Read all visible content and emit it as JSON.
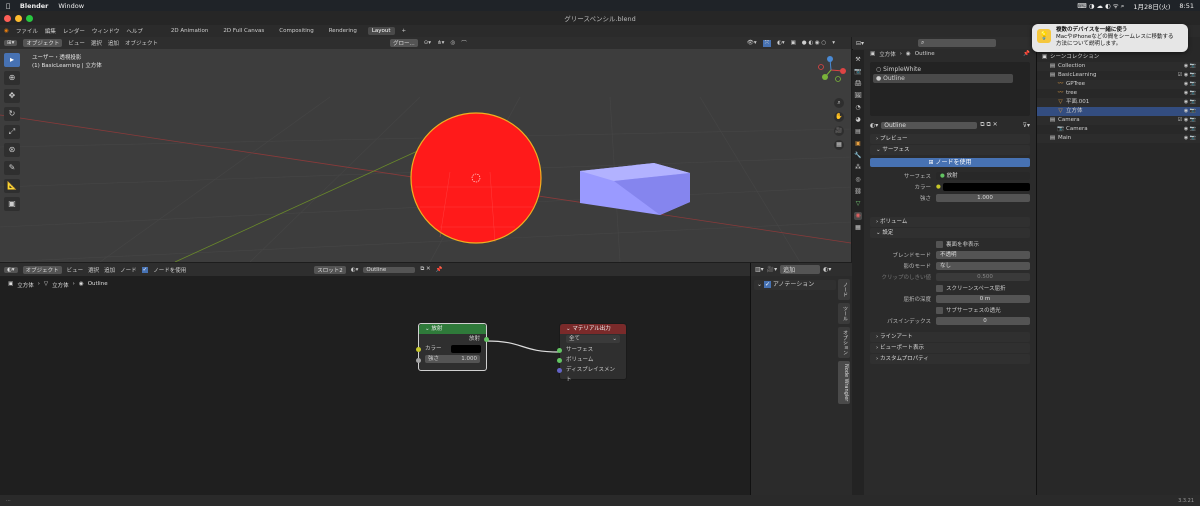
{
  "mac": {
    "app": "Blender",
    "menu": [
      "Window"
    ],
    "date": "1月28日(火)",
    "time": "8:51"
  },
  "window": {
    "title": "グリースペンシル.blend"
  },
  "menubar": {
    "items": [
      "ファイル",
      "編集",
      "レンダー",
      "ウィンドウ",
      "ヘルプ"
    ],
    "workspaces": [
      "2D Animation",
      "2D Full Canvas",
      "Compositing",
      "Rendering",
      "Layout"
    ],
    "active_workspace": "Layout"
  },
  "viewport": {
    "mode": "オブジェクト",
    "menus": [
      "ビュー",
      "選択",
      "追加",
      "オブジェクト"
    ],
    "transform": "グロー...",
    "info_line1": "ユーザー・透視投影",
    "info_line2": "(1) BasicLearning | 立方体",
    "circle_color": "#ff1a1a",
    "cube_color": "#9a9aff"
  },
  "node_editor": {
    "mode": "オブジェクト",
    "menus": [
      "ビュー",
      "選択",
      "追加",
      "ノード"
    ],
    "use_nodes": "ノードを使用",
    "slot": "スロット2",
    "material": "Outline",
    "breadcrumb": [
      "立方体",
      "立方体",
      "Outline"
    ],
    "emission_node": {
      "title": "放射",
      "output": "放射",
      "color_label": "カラー",
      "strength_label": "強さ",
      "strength_value": "1.000",
      "header_color": "#2f7a3a"
    },
    "output_node": {
      "title": "マテリアル出力",
      "target": "全て",
      "inputs": [
        "サーフェス",
        "ボリューム",
        "ディスプレイスメント"
      ],
      "header_color": "#7a2a2a"
    }
  },
  "n_panel": {
    "dropdown": "追加",
    "annotation": "アノテーション",
    "tabs": [
      "ノード",
      "ツール",
      "オプション",
      "Node Wrangler"
    ]
  },
  "properties": {
    "object": "立方体",
    "material": "Outline",
    "slots": [
      "SimpleWhite",
      "Outline"
    ],
    "material_field": "Outline",
    "sections": {
      "preview": "プレビュー",
      "surface": "サーフェス",
      "volume": "ボリューム",
      "settings": "設定",
      "lineart": "ラインアート",
      "viewport": "ビューポート表示",
      "custom": "カスタムプロパティ"
    },
    "use_nodes_button": "ノードを使用",
    "surface_label": "サーフェス",
    "surface_value": "放射",
    "color_label": "カラー",
    "strength_label": "強さ",
    "strength_value": "1.000",
    "backface": "裏面を非表示",
    "blend_label": "ブレンドモード",
    "blend_value": "不透明",
    "shadow_label": "影のモード",
    "shadow_value": "なし",
    "clip_label": "クリップのしきい値",
    "clip_value": "0.500",
    "ssr": "スクリーンスペース屈折",
    "refr_label": "屈折の深度",
    "refr_value": "0 m",
    "sss": "サブサーフェスの透光",
    "pass_label": "パスインデックス",
    "pass_value": "0"
  },
  "outliner": {
    "rows": [
      {
        "name": "シーンコレクション",
        "indent": 0,
        "icon": "▣",
        "vis": ""
      },
      {
        "name": "Collection",
        "indent": 1,
        "icon": "▤",
        "vis": "◉ 📷"
      },
      {
        "name": "BasicLearning",
        "indent": 1,
        "icon": "▤",
        "vis": "☑ ◉ 📷"
      },
      {
        "name": "GPTree",
        "indent": 2,
        "icon": "〰",
        "vis": "◉ 📷"
      },
      {
        "name": "tree",
        "indent": 2,
        "icon": "〰",
        "vis": "◉ 📷"
      },
      {
        "name": "平面.001",
        "indent": 2,
        "icon": "▽",
        "vis": "◉ 📷"
      },
      {
        "name": "立方体",
        "indent": 2,
        "icon": "▽",
        "vis": "◉ 📷",
        "selected": true
      },
      {
        "name": "Camera",
        "indent": 1,
        "icon": "▤",
        "vis": "☑ ◉ 📷"
      },
      {
        "name": "Camera",
        "indent": 2,
        "icon": "📷",
        "vis": "◉ 📷"
      },
      {
        "name": "Main",
        "indent": 1,
        "icon": "▤",
        "vis": "◉ 📷"
      }
    ]
  },
  "notification": {
    "line1": "複数のデバイスを一緒に使う",
    "line2": "MacやiPhoneなどの間をシームレスに移動する",
    "line3": "方法について説明します。"
  },
  "status": {
    "version": "3.3.21"
  }
}
